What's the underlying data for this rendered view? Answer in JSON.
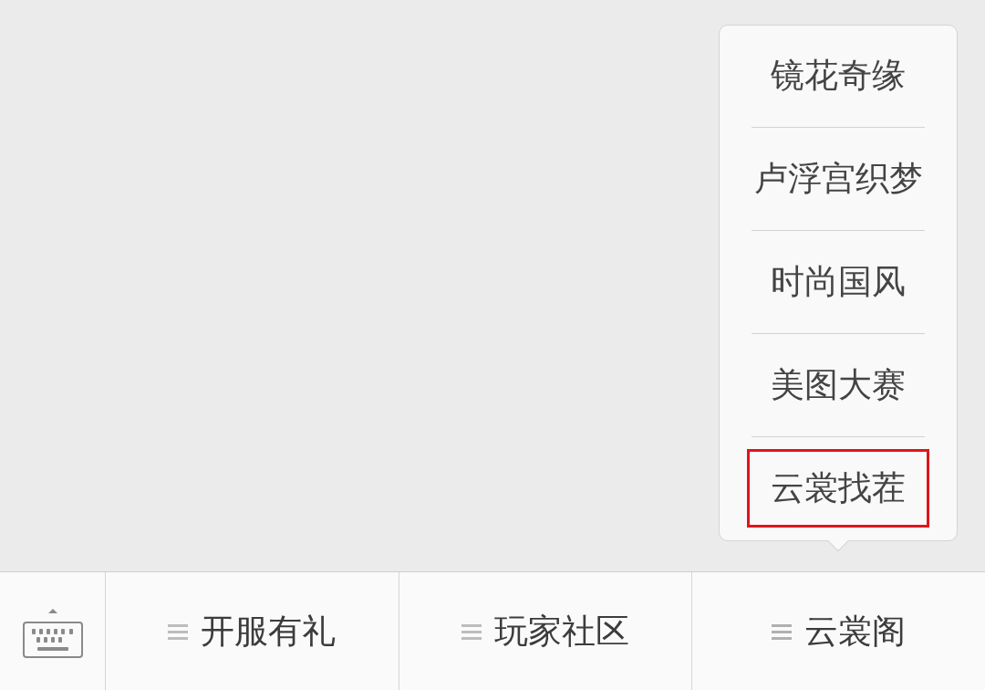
{
  "menu": [
    {
      "label": "开服有礼",
      "expanded": false
    },
    {
      "label": "玩家社区",
      "expanded": false
    },
    {
      "label": "云裳阁",
      "expanded": true,
      "submenu": [
        {
          "label": "镜花奇缘",
          "selected": false
        },
        {
          "label": "卢浮宫织梦",
          "selected": false
        },
        {
          "label": "时尚国风",
          "selected": false
        },
        {
          "label": "美图大赛",
          "selected": false
        },
        {
          "label": "云裳找茬",
          "selected": true
        }
      ]
    }
  ]
}
